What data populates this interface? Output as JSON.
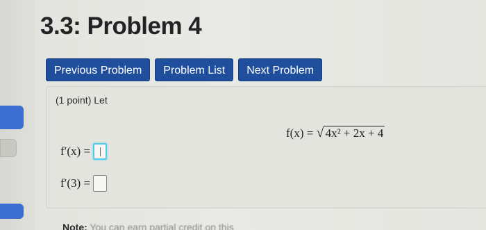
{
  "header": {
    "title": "3.3: Problem 4"
  },
  "nav": {
    "previous_label": "Previous Problem",
    "list_label": "Problem List",
    "next_label": "Next Problem"
  },
  "problem": {
    "points_text": "(1 point) Let",
    "formula_lhs": "f(x) = ",
    "formula_radicand": "4x² + 2x + 4",
    "answers": [
      {
        "label": "f′(x) =",
        "value": ""
      },
      {
        "label": "f′(3) =",
        "value": ""
      }
    ]
  },
  "note": {
    "bold": "Note:",
    "text": " You can earn partial credit on this"
  },
  "colors": {
    "button_bg": "#1f4e9c",
    "sidebar_accent": "#3d6fd2",
    "input_focus": "#53c9ea"
  }
}
